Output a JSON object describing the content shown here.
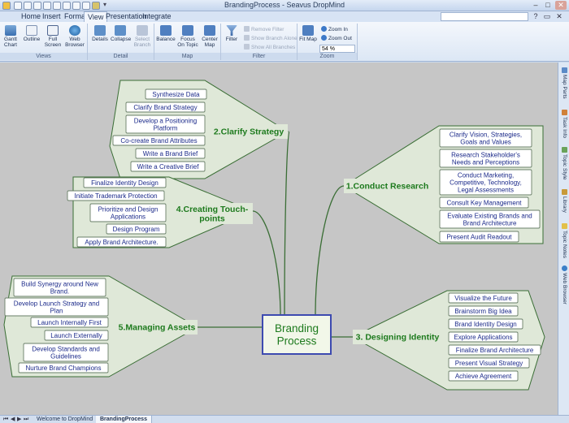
{
  "window": {
    "title": "BrandingProcess - Seavus DropMind"
  },
  "menu": {
    "tabs": [
      {
        "label": "Home"
      },
      {
        "label": "Insert"
      },
      {
        "label": "Format"
      },
      {
        "label": "View"
      },
      {
        "label": "Presentation"
      },
      {
        "label": "Integrate"
      }
    ],
    "active_tab": "View"
  },
  "ribbon": {
    "views": {
      "label": "Views",
      "gantt": "Gantt Chart",
      "outline": "Outline",
      "fullscreen": "Full Screen",
      "web": "Web Browser"
    },
    "detail": {
      "label": "Detail",
      "details": "Details",
      "collapse": "Collapse",
      "select_branch": "Select Branch"
    },
    "map": {
      "label": "Map",
      "balance": "Balance",
      "focus": "Focus On Topic",
      "center": "Center Map"
    },
    "filter": {
      "label": "Filter",
      "filter": "Filter",
      "remove": "Remove Filter",
      "show_branch": "Show Branch Alone",
      "show_all": "Show All Branches"
    },
    "zoom": {
      "label": "Zoom",
      "fit": "Fit Map",
      "zoom_in": "Zoom In",
      "zoom_out": "Zoom Out",
      "level": "54 %"
    }
  },
  "dock": [
    "Map Parts",
    "Task Info",
    "Topic Style",
    "Library",
    "Topic Notes",
    "Web Browser"
  ],
  "doctabs": [
    "Welcome to DropMind",
    "BrandingProcess"
  ],
  "colors": {
    "node_fill": "#ffffff",
    "node_stroke": "#3a6a39",
    "group_fill": "#dfe8d8",
    "main_text": "#1d7a1d",
    "sub_text": "#1b2a8a",
    "central_fill": "#f2f7e9",
    "central_stroke": "#3d4ab0",
    "line": "#3a6e35"
  },
  "map": {
    "central": {
      "label": "Branding Process"
    },
    "branches": [
      {
        "label": "1.Conduct Research",
        "subtopics": [
          "Clarify Vision, Strategies, Goals and Values",
          "Research Stakeholder's Needs and Perceptions",
          "Conduct Marketing, Competitive, Technology, Legal Assessments",
          "Consult Key Management",
          "Evaluate Existing Brands and Brand Architecture",
          "Present Audit Readout"
        ]
      },
      {
        "label": "2.Clarify Strategy",
        "subtopics": [
          "Synthesize Data",
          "Clarify Brand Strategy",
          "Develop a Positioning Platform",
          "Co-create Brand Attributes",
          "Write a Brand Brief",
          "Write a Creative Brief"
        ]
      },
      {
        "label": "3. Designing Identity",
        "subtopics": [
          "Visualize the Future",
          "Brainstorm Big Idea",
          "Brand Identity Design",
          "Explore Applications",
          "Finalize Brand Architecture",
          "Present Visual Strategy",
          "Achieve Agreement"
        ]
      },
      {
        "label": "4.Creating Touch-points",
        "subtopics": [
          "Finalize Identity Design",
          "Initiate Trademark Protection",
          "Prioritize and Design Applications",
          "Design Program",
          "Apply Brand Architecture."
        ]
      },
      {
        "label": "5.Managing Assets",
        "subtopics": [
          "Build Synergy around New Brand.",
          "Develop Launch Strategy and Plan",
          "Launch Internally First",
          "Launch Externally",
          "Develop Standards and Guidelines",
          "Nurture Brand Champions"
        ]
      }
    ]
  }
}
